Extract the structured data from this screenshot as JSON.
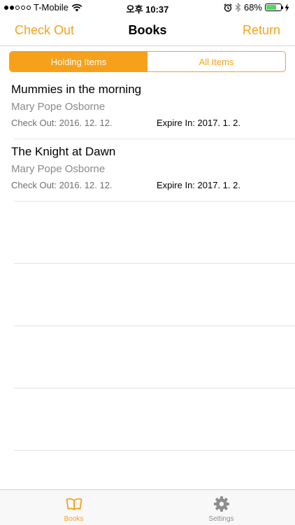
{
  "status_bar": {
    "carrier": "T-Mobile",
    "time": "오후 10:37",
    "battery_percent": "68%",
    "battery_level": 0.68,
    "battery_color": "#4cd964"
  },
  "nav": {
    "left_label": "Check Out",
    "title": "Books",
    "right_label": "Return",
    "accent_color": "#f7a11a"
  },
  "segmented": {
    "options": [
      "Holding Items",
      "All Items"
    ],
    "selected": "Holding Items"
  },
  "books": [
    {
      "title": "Mummies in the morning",
      "author": "Mary Pope Osborne",
      "check_out": "Check Out: 2016. 12. 12.",
      "expire": "Expire In: 2017. 1. 2."
    },
    {
      "title": "The Knight at Dawn",
      "author": "Mary Pope Osborne",
      "check_out": "Check Out: 2016. 12. 12.",
      "expire": "Expire In: 2017. 1. 2."
    }
  ],
  "tab_bar": {
    "tabs": [
      {
        "label": "Books",
        "icon": "book-icon",
        "active": true
      },
      {
        "label": "Settings",
        "icon": "gear-icon",
        "active": false
      }
    ]
  }
}
